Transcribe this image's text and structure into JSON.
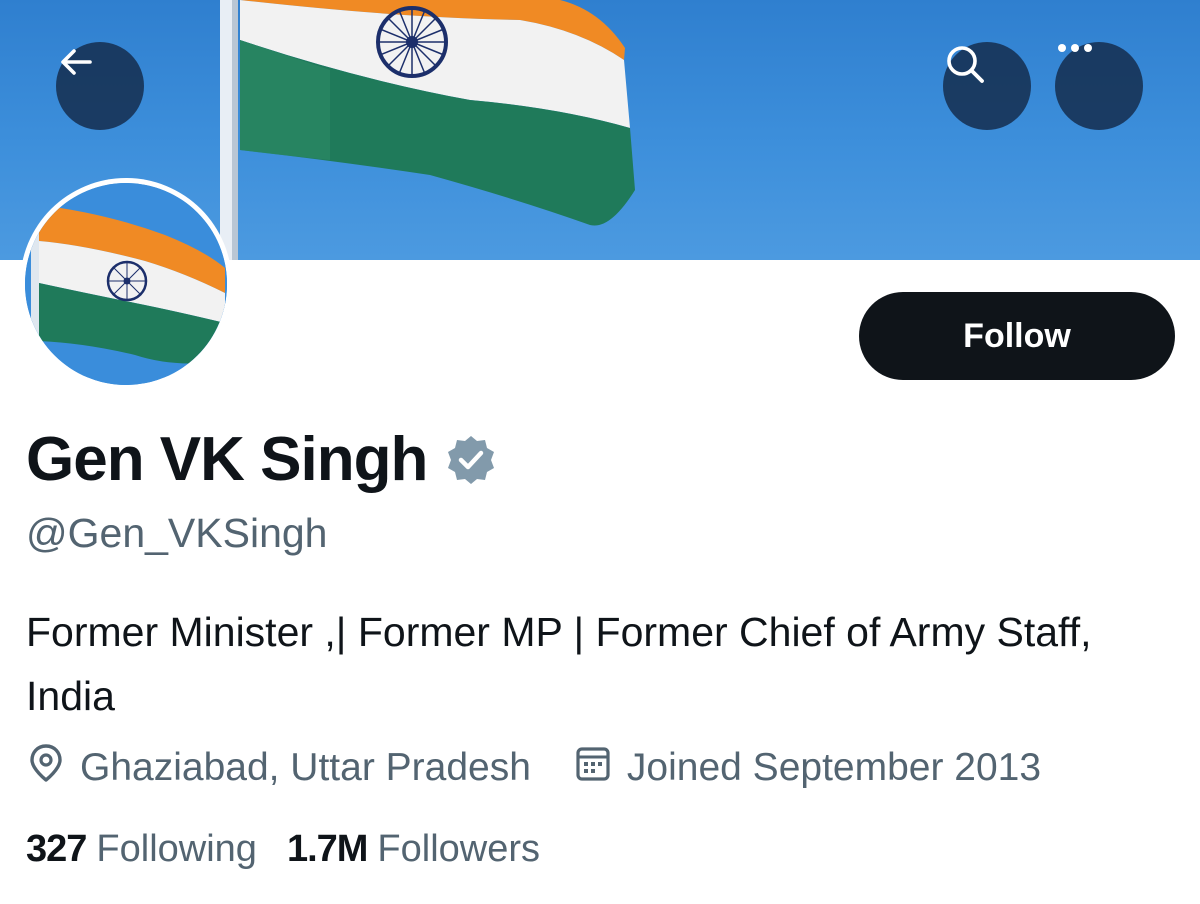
{
  "profile": {
    "display_name": "Gen VK Singh",
    "handle": "@Gen_VKSingh",
    "bio": "Former Minister ,| Former MP | Former Chief of Army Staff, India",
    "location": "Ghaziabad, Uttar Pradesh",
    "joined": "Joined September 2013",
    "verified_badge_color": "#829aab"
  },
  "actions": {
    "follow_label": "Follow"
  },
  "stats": {
    "following_count": "327",
    "following_label": "Following",
    "followers_count": "1.7M",
    "followers_label": "Followers"
  },
  "icons": {
    "back": "arrow-left-icon",
    "search": "search-icon",
    "more": "more-horizontal-icon",
    "location": "location-pin-icon",
    "calendar": "calendar-icon",
    "verified": "verified-badge-icon"
  },
  "colors": {
    "text_primary": "#0f1419",
    "text_secondary": "#536471",
    "button_dark": "#0f1419",
    "flag_saffron": "#f08a24",
    "flag_white": "#f2f2f2",
    "flag_green": "#1f7a5a",
    "chakra": "#1c2f6b",
    "sky": "#3a8ddb"
  }
}
